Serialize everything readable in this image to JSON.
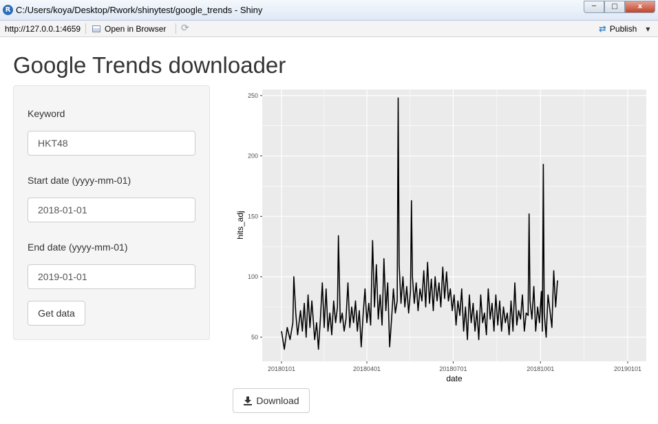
{
  "window": {
    "title": "C:/Users/koya/Desktop/Rwork/shinytest/google_trends - Shiny",
    "icon": "r-logo-icon",
    "minimize_label": "─",
    "maximize_label": "□",
    "close_label": "x"
  },
  "toolbar": {
    "url": "http://127.0.0.1:4659",
    "open_in_browser_label": "Open in Browser",
    "refresh_icon": "⟳",
    "publish_label": "Publish",
    "publish_icon": "publish-icon"
  },
  "app": {
    "title": "Google Trends downloader",
    "keyword_label": "Keyword",
    "keyword_value": "HKT48",
    "start_date_label": "Start date (yyyy-mm-01)",
    "start_date_value": "2018-01-01",
    "end_date_label": "End date (yyyy-mm-01)",
    "end_date_value": "2019-01-01",
    "get_data_label": "Get data",
    "download_label": "Download"
  },
  "colors": {
    "panel_bg": "#ebebeb",
    "grid": "#ffffff",
    "line": "#000000"
  },
  "chart_data": {
    "type": "line",
    "xlabel": "date",
    "ylabel": "hits_adj",
    "x_range": [
      "2018-01-01",
      "2019-01-01"
    ],
    "ylim": [
      30,
      255
    ],
    "x_ticks": [
      "20180101",
      "20180401",
      "20180701",
      "20181001",
      "20190101"
    ],
    "y_ticks": [
      50,
      100,
      150,
      200,
      250
    ],
    "grid": true,
    "series": [
      {
        "values": [
          [
            0,
            55
          ],
          [
            3,
            40
          ],
          [
            6,
            58
          ],
          [
            9,
            48
          ],
          [
            12,
            62
          ],
          [
            13,
            100
          ],
          [
            15,
            70
          ],
          [
            17,
            52
          ],
          [
            20,
            72
          ],
          [
            22,
            55
          ],
          [
            24,
            78
          ],
          [
            26,
            50
          ],
          [
            28,
            85
          ],
          [
            30,
            58
          ],
          [
            32,
            80
          ],
          [
            35,
            48
          ],
          [
            37,
            62
          ],
          [
            39,
            40
          ],
          [
            41,
            65
          ],
          [
            43,
            95
          ],
          [
            45,
            58
          ],
          [
            47,
            90
          ],
          [
            49,
            55
          ],
          [
            51,
            70
          ],
          [
            53,
            52
          ],
          [
            55,
            80
          ],
          [
            57,
            62
          ],
          [
            59,
            75
          ],
          [
            60,
            134
          ],
          [
            62,
            62
          ],
          [
            64,
            70
          ],
          [
            66,
            55
          ],
          [
            68,
            65
          ],
          [
            70,
            95
          ],
          [
            72,
            58
          ],
          [
            74,
            75
          ],
          [
            76,
            62
          ],
          [
            78,
            80
          ],
          [
            80,
            55
          ],
          [
            82,
            72
          ],
          [
            84,
            42
          ],
          [
            86,
            68
          ],
          [
            88,
            90
          ],
          [
            90,
            62
          ],
          [
            92,
            78
          ],
          [
            94,
            60
          ],
          [
            96,
            130
          ],
          [
            98,
            75
          ],
          [
            100,
            110
          ],
          [
            102,
            65
          ],
          [
            104,
            85
          ],
          [
            106,
            60
          ],
          [
            108,
            115
          ],
          [
            110,
            72
          ],
          [
            112,
            95
          ],
          [
            114,
            42
          ],
          [
            116,
            65
          ],
          [
            118,
            90
          ],
          [
            120,
            70
          ],
          [
            122,
            80
          ],
          [
            123,
            248
          ],
          [
            124,
            110
          ],
          [
            126,
            78
          ],
          [
            128,
            100
          ],
          [
            130,
            75
          ],
          [
            132,
            92
          ],
          [
            134,
            70
          ],
          [
            136,
            88
          ],
          [
            137,
            163
          ],
          [
            138,
            100
          ],
          [
            140,
            78
          ],
          [
            142,
            95
          ],
          [
            144,
            72
          ],
          [
            146,
            90
          ],
          [
            148,
            80
          ],
          [
            150,
            105
          ],
          [
            152,
            75
          ],
          [
            154,
            112
          ],
          [
            156,
            78
          ],
          [
            158,
            98
          ],
          [
            160,
            72
          ],
          [
            162,
            100
          ],
          [
            164,
            80
          ],
          [
            166,
            95
          ],
          [
            168,
            75
          ],
          [
            170,
            108
          ],
          [
            172,
            82
          ],
          [
            174,
            104
          ],
          [
            176,
            80
          ],
          [
            178,
            90
          ],
          [
            180,
            72
          ],
          [
            182,
            85
          ],
          [
            184,
            60
          ],
          [
            186,
            80
          ],
          [
            188,
            68
          ],
          [
            190,
            90
          ],
          [
            192,
            55
          ],
          [
            194,
            75
          ],
          [
            196,
            48
          ],
          [
            198,
            85
          ],
          [
            200,
            62
          ],
          [
            202,
            78
          ],
          [
            204,
            55
          ],
          [
            206,
            72
          ],
          [
            208,
            48
          ],
          [
            210,
            85
          ],
          [
            212,
            62
          ],
          [
            214,
            70
          ],
          [
            216,
            52
          ],
          [
            218,
            90
          ],
          [
            220,
            65
          ],
          [
            222,
            78
          ],
          [
            224,
            55
          ],
          [
            226,
            85
          ],
          [
            228,
            60
          ],
          [
            230,
            80
          ],
          [
            232,
            55
          ],
          [
            234,
            75
          ],
          [
            236,
            62
          ],
          [
            238,
            70
          ],
          [
            240,
            52
          ],
          [
            242,
            80
          ],
          [
            244,
            55
          ],
          [
            246,
            95
          ],
          [
            248,
            60
          ],
          [
            250,
            72
          ],
          [
            252,
            65
          ],
          [
            254,
            85
          ],
          [
            256,
            55
          ],
          [
            258,
            70
          ],
          [
            260,
            68
          ],
          [
            261,
            152
          ],
          [
            262,
            80
          ],
          [
            264,
            65
          ],
          [
            266,
            92
          ],
          [
            268,
            55
          ],
          [
            270,
            75
          ],
          [
            272,
            62
          ],
          [
            274,
            88
          ],
          [
            275,
            55
          ],
          [
            276,
            193
          ],
          [
            277,
            70
          ],
          [
            279,
            50
          ],
          [
            281,
            85
          ],
          [
            283,
            72
          ],
          [
            285,
            58
          ],
          [
            287,
            105
          ],
          [
            289,
            75
          ],
          [
            291,
            97
          ]
        ]
      }
    ]
  }
}
